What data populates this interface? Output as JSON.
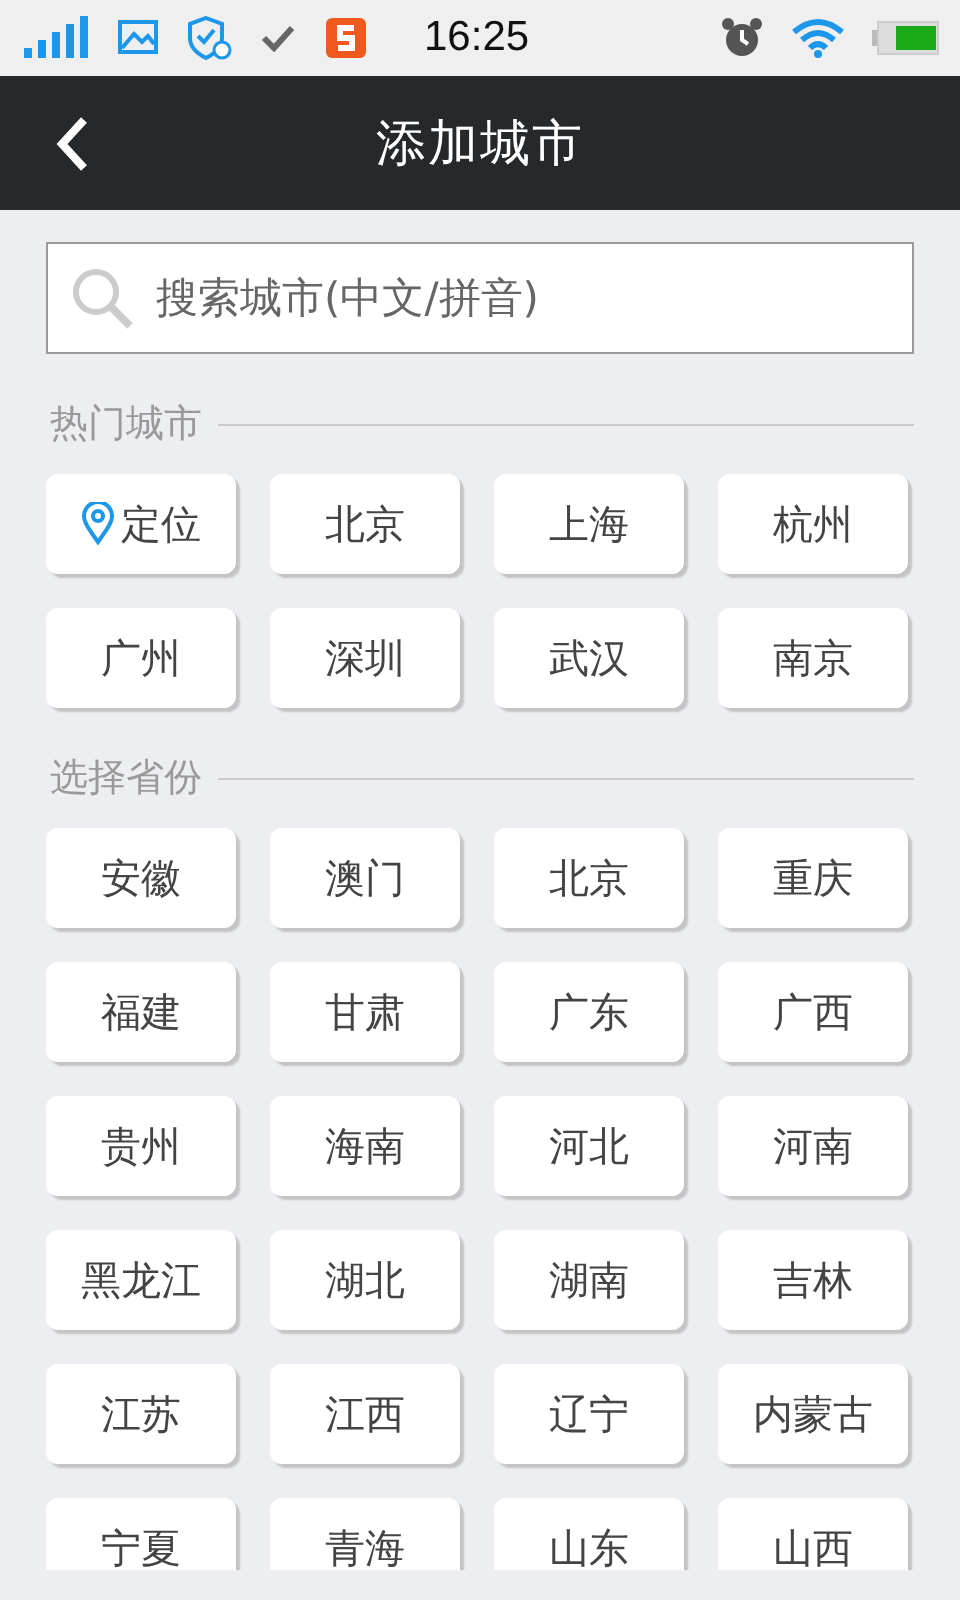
{
  "status_bar": {
    "time": "16:25"
  },
  "header": {
    "title": "添加城市"
  },
  "search": {
    "placeholder": "搜索城市(中文/拼音)"
  },
  "sections": [
    {
      "title": "热门城市",
      "items": [
        {
          "label": "定位",
          "kind": "locate"
        },
        {
          "label": "北京",
          "kind": "city"
        },
        {
          "label": "上海",
          "kind": "city"
        },
        {
          "label": "杭州",
          "kind": "city"
        },
        {
          "label": "广州",
          "kind": "city"
        },
        {
          "label": "深圳",
          "kind": "city"
        },
        {
          "label": "武汉",
          "kind": "city"
        },
        {
          "label": "南京",
          "kind": "city"
        }
      ]
    },
    {
      "title": "选择省份",
      "items": [
        {
          "label": "安徽",
          "kind": "city"
        },
        {
          "label": "澳门",
          "kind": "city"
        },
        {
          "label": "北京",
          "kind": "city"
        },
        {
          "label": "重庆",
          "kind": "city"
        },
        {
          "label": "福建",
          "kind": "city"
        },
        {
          "label": "甘肃",
          "kind": "city"
        },
        {
          "label": "广东",
          "kind": "city"
        },
        {
          "label": "广西",
          "kind": "city"
        },
        {
          "label": "贵州",
          "kind": "city"
        },
        {
          "label": "海南",
          "kind": "city"
        },
        {
          "label": "河北",
          "kind": "city"
        },
        {
          "label": "河南",
          "kind": "city"
        },
        {
          "label": "黑龙江",
          "kind": "city"
        },
        {
          "label": "湖北",
          "kind": "city"
        },
        {
          "label": "湖南",
          "kind": "city"
        },
        {
          "label": "吉林",
          "kind": "city"
        },
        {
          "label": "江苏",
          "kind": "city"
        },
        {
          "label": "江西",
          "kind": "city"
        },
        {
          "label": "辽宁",
          "kind": "city"
        },
        {
          "label": "内蒙古",
          "kind": "city"
        },
        {
          "label": "宁夏",
          "kind": "city"
        },
        {
          "label": "青海",
          "kind": "city"
        },
        {
          "label": "山东",
          "kind": "city"
        },
        {
          "label": "山西",
          "kind": "city"
        }
      ]
    }
  ]
}
